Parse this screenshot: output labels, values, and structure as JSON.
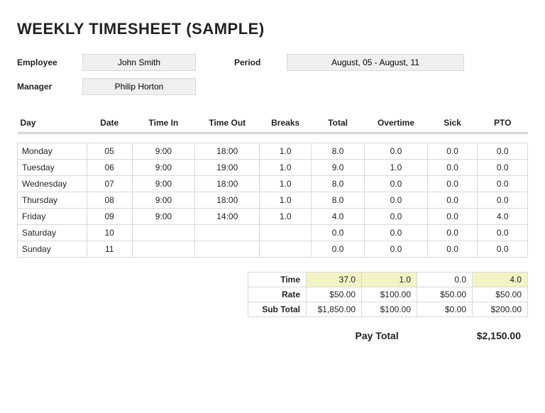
{
  "title": "WEEKLY TIMESHEET (SAMPLE)",
  "labels": {
    "employee": "Employee",
    "manager": "Manager",
    "period": "Period",
    "pay_total": "Pay Total"
  },
  "fields": {
    "employee": "John Smith",
    "manager": "Philip Horton",
    "period": "August, 05 - August, 11"
  },
  "columns": {
    "day": "Day",
    "date": "Date",
    "time_in": "Time In",
    "time_out": "Time Out",
    "breaks": "Breaks",
    "total": "Total",
    "overtime": "Overtime",
    "sick": "Sick",
    "pto": "PTO"
  },
  "rows": [
    {
      "day": "Monday",
      "date": "05",
      "time_in": "9:00",
      "time_out": "18:00",
      "breaks": "1.0",
      "total": "8.0",
      "overtime": "0.0",
      "sick": "0.0",
      "pto": "0.0"
    },
    {
      "day": "Tuesday",
      "date": "06",
      "time_in": "9:00",
      "time_out": "19:00",
      "breaks": "1.0",
      "total": "9.0",
      "overtime": "1.0",
      "sick": "0.0",
      "pto": "0.0"
    },
    {
      "day": "Wednesday",
      "date": "07",
      "time_in": "9:00",
      "time_out": "18:00",
      "breaks": "1.0",
      "total": "8.0",
      "overtime": "0.0",
      "sick": "0.0",
      "pto": "0.0"
    },
    {
      "day": "Thursday",
      "date": "08",
      "time_in": "9:00",
      "time_out": "18:00",
      "breaks": "1.0",
      "total": "8.0",
      "overtime": "0.0",
      "sick": "0.0",
      "pto": "0.0"
    },
    {
      "day": "Friday",
      "date": "09",
      "time_in": "9:00",
      "time_out": "14:00",
      "breaks": "1.0",
      "total": "4.0",
      "overtime": "0.0",
      "sick": "0.0",
      "pto": "4.0"
    },
    {
      "day": "Saturday",
      "date": "10",
      "time_in": "",
      "time_out": "",
      "breaks": "",
      "total": "0.0",
      "overtime": "0.0",
      "sick": "0.0",
      "pto": "0.0"
    },
    {
      "day": "Sunday",
      "date": "11",
      "time_in": "",
      "time_out": "",
      "breaks": "",
      "total": "0.0",
      "overtime": "0.0",
      "sick": "0.0",
      "pto": "0.0"
    }
  ],
  "summary": {
    "labels": {
      "time": "Time",
      "rate": "Rate",
      "subtotal": "Sub Total"
    },
    "time": {
      "total": "37.0",
      "overtime": "1.0",
      "sick": "0.0",
      "pto": "4.0"
    },
    "rate": {
      "total": "$50.00",
      "overtime": "$100.00",
      "sick": "$50.00",
      "pto": "$50.00"
    },
    "subtotal": {
      "total": "$1,850.00",
      "overtime": "$100.00",
      "sick": "$0.00",
      "pto": "$200.00"
    }
  },
  "pay_total": "$2,150.00",
  "chart_data": {
    "type": "table",
    "title": "Weekly Timesheet",
    "columns": [
      "Day",
      "Date",
      "Time In",
      "Time Out",
      "Breaks",
      "Total",
      "Overtime",
      "Sick",
      "PTO"
    ],
    "rows": [
      [
        "Monday",
        "05",
        "9:00",
        "18:00",
        1.0,
        8.0,
        0.0,
        0.0,
        0.0
      ],
      [
        "Tuesday",
        "06",
        "9:00",
        "19:00",
        1.0,
        9.0,
        1.0,
        0.0,
        0.0
      ],
      [
        "Wednesday",
        "07",
        "9:00",
        "18:00",
        1.0,
        8.0,
        0.0,
        0.0,
        0.0
      ],
      [
        "Thursday",
        "08",
        "9:00",
        "18:00",
        1.0,
        8.0,
        0.0,
        0.0,
        0.0
      ],
      [
        "Friday",
        "09",
        "9:00",
        "14:00",
        1.0,
        4.0,
        0.0,
        0.0,
        4.0
      ],
      [
        "Saturday",
        "10",
        null,
        null,
        null,
        0.0,
        0.0,
        0.0,
        0.0
      ],
      [
        "Sunday",
        "11",
        null,
        null,
        null,
        0.0,
        0.0,
        0.0,
        0.0
      ]
    ],
    "totals": {
      "hours": 37.0,
      "overtime": 1.0,
      "sick": 0.0,
      "pto": 4.0
    },
    "rates_usd": {
      "regular": 50.0,
      "overtime": 100.0,
      "sick": 50.0,
      "pto": 50.0
    },
    "subtotals_usd": {
      "regular": 1850.0,
      "overtime": 100.0,
      "sick": 0.0,
      "pto": 200.0
    },
    "pay_total_usd": 2150.0
  }
}
